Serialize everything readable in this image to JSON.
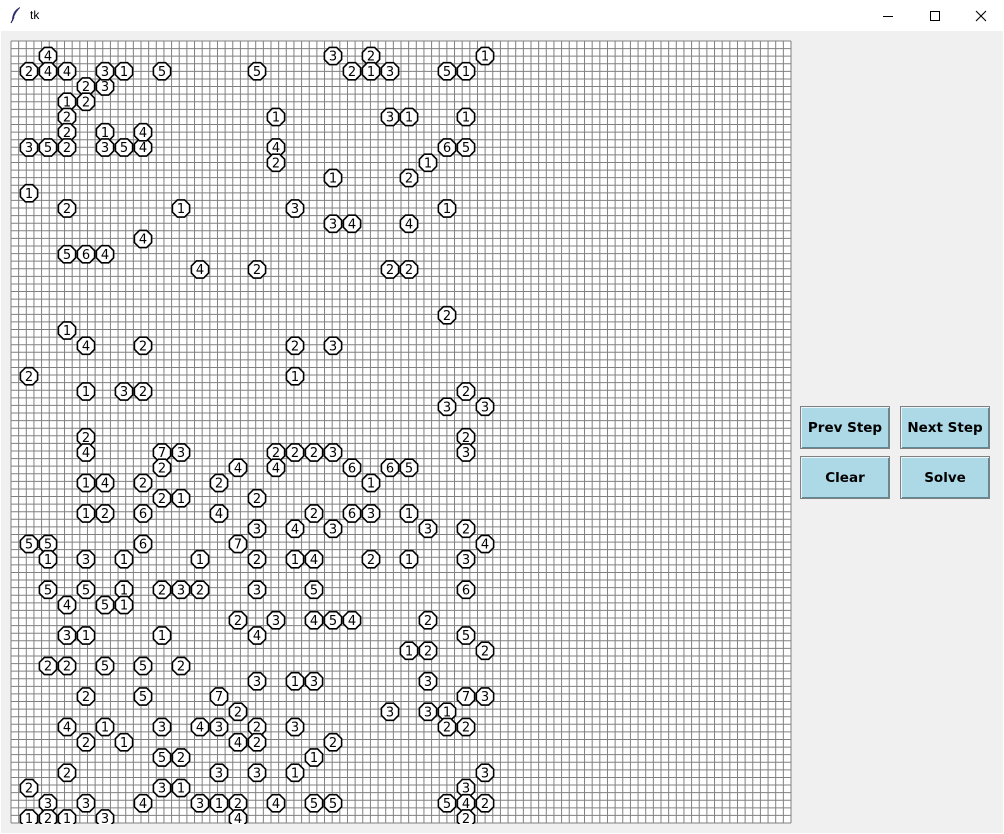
{
  "window": {
    "title": "tk"
  },
  "buttons": {
    "prev": "Prev Step",
    "next": "Next Step",
    "clear": "Clear",
    "solve": "Solve"
  },
  "grid": {
    "cols": 41,
    "rows": 41,
    "line_color": "#808080",
    "background": "#ffffff"
  },
  "islands": [
    [
      1,
      1,
      2
    ],
    [
      2,
      0,
      4
    ],
    [
      2,
      1,
      4
    ],
    [
      3,
      1,
      4
    ],
    [
      3,
      3,
      1
    ],
    [
      3,
      4,
      2
    ],
    [
      4,
      2,
      2
    ],
    [
      4,
      3,
      2
    ],
    [
      5,
      2,
      3
    ],
    [
      5,
      1,
      3
    ],
    [
      6,
      1,
      1
    ],
    [
      8,
      1,
      5
    ],
    [
      13,
      1,
      5
    ],
    [
      14,
      4,
      1
    ],
    [
      17,
      0,
      3
    ],
    [
      18,
      1,
      2
    ],
    [
      19,
      0,
      2
    ],
    [
      19,
      1,
      1
    ],
    [
      20,
      1,
      3
    ],
    [
      20,
      4,
      3
    ],
    [
      21,
      4,
      1
    ],
    [
      23,
      1,
      5
    ],
    [
      24,
      1,
      1
    ],
    [
      24,
      4,
      1
    ],
    [
      25,
      0,
      1
    ],
    [
      3,
      5,
      2
    ],
    [
      1,
      6,
      3
    ],
    [
      2,
      6,
      5
    ],
    [
      3,
      6,
      2
    ],
    [
      5,
      5,
      1
    ],
    [
      5,
      6,
      3
    ],
    [
      6,
      6,
      5
    ],
    [
      7,
      6,
      4
    ],
    [
      7,
      5,
      4
    ],
    [
      14,
      6,
      4
    ],
    [
      14,
      7,
      2
    ],
    [
      17,
      8,
      1
    ],
    [
      23,
      6,
      6
    ],
    [
      22,
      7,
      1
    ],
    [
      21,
      8,
      2
    ],
    [
      24,
      6,
      5
    ],
    [
      1,
      9,
      1
    ],
    [
      3,
      10,
      2
    ],
    [
      9,
      10,
      1
    ],
    [
      15,
      10,
      3
    ],
    [
      17,
      11,
      3
    ],
    [
      18,
      11,
      4
    ],
    [
      21,
      11,
      4
    ],
    [
      23,
      10,
      1
    ],
    [
      7,
      12,
      4
    ],
    [
      3,
      13,
      5
    ],
    [
      4,
      13,
      6
    ],
    [
      5,
      13,
      4
    ],
    [
      10,
      14,
      4
    ],
    [
      13,
      14,
      2
    ],
    [
      20,
      14,
      2
    ],
    [
      21,
      14,
      2
    ],
    [
      23,
      17,
      2
    ],
    [
      3,
      18,
      1
    ],
    [
      4,
      19,
      4
    ],
    [
      7,
      19,
      2
    ],
    [
      15,
      19,
      2
    ],
    [
      17,
      19,
      3
    ],
    [
      1,
      21,
      2
    ],
    [
      15,
      21,
      1
    ],
    [
      4,
      22,
      1
    ],
    [
      6,
      22,
      3
    ],
    [
      7,
      22,
      2
    ],
    [
      24,
      22,
      2
    ],
    [
      23,
      23,
      3
    ],
    [
      25,
      23,
      3
    ],
    [
      4,
      25,
      2
    ],
    [
      24,
      25,
      2
    ],
    [
      4,
      26,
      4
    ],
    [
      8,
      26,
      7
    ],
    [
      9,
      26,
      3
    ],
    [
      14,
      26,
      2
    ],
    [
      15,
      26,
      2
    ],
    [
      16,
      26,
      2
    ],
    [
      17,
      26,
      3
    ],
    [
      24,
      26,
      3
    ],
    [
      8,
      27,
      2
    ],
    [
      12,
      27,
      4
    ],
    [
      14,
      27,
      4
    ],
    [
      18,
      27,
      6
    ],
    [
      20,
      27,
      6
    ],
    [
      21,
      27,
      5
    ],
    [
      4,
      28,
      1
    ],
    [
      5,
      28,
      4
    ],
    [
      7,
      28,
      2
    ],
    [
      11,
      28,
      2
    ],
    [
      19,
      28,
      1
    ],
    [
      8,
      29,
      2
    ],
    [
      9,
      29,
      1
    ],
    [
      13,
      29,
      2
    ],
    [
      4,
      30,
      1
    ],
    [
      5,
      30,
      2
    ],
    [
      7,
      30,
      6
    ],
    [
      11,
      30,
      4
    ],
    [
      16,
      30,
      2
    ],
    [
      18,
      30,
      6
    ],
    [
      19,
      30,
      3
    ],
    [
      21,
      30,
      1
    ],
    [
      13,
      31,
      3
    ],
    [
      15,
      31,
      4
    ],
    [
      17,
      31,
      3
    ],
    [
      22,
      31,
      3
    ],
    [
      24,
      31,
      2
    ],
    [
      1,
      32,
      5
    ],
    [
      2,
      32,
      5
    ],
    [
      7,
      32,
      6
    ],
    [
      12,
      32,
      7
    ],
    [
      25,
      32,
      4
    ],
    [
      2,
      33,
      1
    ],
    [
      4,
      33,
      3
    ],
    [
      6,
      33,
      1
    ],
    [
      10,
      33,
      1
    ],
    [
      13,
      33,
      2
    ],
    [
      15,
      33,
      1
    ],
    [
      16,
      33,
      4
    ],
    [
      19,
      33,
      2
    ],
    [
      21,
      33,
      1
    ],
    [
      24,
      33,
      3
    ],
    [
      2,
      35,
      5
    ],
    [
      4,
      35,
      5
    ],
    [
      6,
      35,
      1
    ],
    [
      8,
      35,
      2
    ],
    [
      9,
      35,
      3
    ],
    [
      10,
      35,
      2
    ],
    [
      13,
      35,
      3
    ],
    [
      16,
      35,
      5
    ],
    [
      24,
      35,
      6
    ],
    [
      3,
      36,
      4
    ],
    [
      5,
      36,
      5
    ],
    [
      6,
      36,
      1
    ],
    [
      12,
      37,
      2
    ],
    [
      14,
      37,
      3
    ],
    [
      16,
      37,
      4
    ],
    [
      17,
      37,
      5
    ],
    [
      18,
      37,
      4
    ],
    [
      22,
      37,
      2
    ],
    [
      3,
      38,
      3
    ],
    [
      4,
      38,
      1
    ],
    [
      8,
      38,
      1
    ],
    [
      13,
      38,
      4
    ],
    [
      24,
      38,
      5
    ],
    [
      21,
      39,
      1
    ],
    [
      22,
      39,
      2
    ],
    [
      25,
      39,
      2
    ],
    [
      2,
      40,
      2
    ],
    [
      3,
      40,
      2
    ],
    [
      5,
      40,
      5
    ],
    [
      7,
      40,
      5
    ],
    [
      9,
      40,
      2
    ],
    [
      13,
      41,
      3
    ],
    [
      15,
      41,
      1
    ],
    [
      16,
      41,
      3
    ],
    [
      22,
      41,
      3
    ],
    [
      4,
      42,
      2
    ],
    [
      7,
      42,
      5
    ],
    [
      11,
      42,
      7
    ],
    [
      12,
      43,
      2
    ],
    [
      20,
      43,
      3
    ],
    [
      22,
      43,
      3
    ],
    [
      23,
      43,
      1
    ],
    [
      24,
      42,
      7
    ],
    [
      25,
      42,
      3
    ],
    [
      3,
      44,
      4
    ],
    [
      5,
      44,
      1
    ],
    [
      8,
      44,
      3
    ],
    [
      10,
      44,
      4
    ],
    [
      11,
      44,
      3
    ],
    [
      12,
      45,
      4
    ],
    [
      13,
      44,
      2
    ],
    [
      15,
      44,
      3
    ],
    [
      23,
      44,
      2
    ],
    [
      24,
      44,
      2
    ],
    [
      4,
      45,
      2
    ],
    [
      6,
      45,
      1
    ],
    [
      13,
      45,
      2
    ],
    [
      17,
      45,
      2
    ],
    [
      8,
      46,
      5
    ],
    [
      9,
      46,
      2
    ],
    [
      16,
      46,
      1
    ],
    [
      3,
      47,
      2
    ],
    [
      11,
      47,
      3
    ],
    [
      13,
      47,
      3
    ],
    [
      15,
      47,
      1
    ],
    [
      25,
      47,
      3
    ],
    [
      1,
      48,
      2
    ],
    [
      8,
      48,
      3
    ],
    [
      9,
      48,
      1
    ],
    [
      24,
      48,
      3
    ],
    [
      2,
      49,
      3
    ],
    [
      4,
      49,
      3
    ],
    [
      7,
      49,
      4
    ],
    [
      10,
      49,
      3
    ],
    [
      11,
      49,
      1
    ],
    [
      12,
      49,
      2
    ],
    [
      14,
      49,
      4
    ],
    [
      16,
      49,
      5
    ],
    [
      17,
      49,
      5
    ],
    [
      23,
      49,
      5
    ],
    [
      24,
      49,
      4
    ],
    [
      25,
      49,
      2
    ],
    [
      1,
      50,
      1
    ],
    [
      2,
      50,
      2
    ],
    [
      3,
      50,
      1
    ],
    [
      5,
      50,
      3
    ],
    [
      12,
      50,
      4
    ],
    [
      24,
      50,
      2
    ]
  ]
}
